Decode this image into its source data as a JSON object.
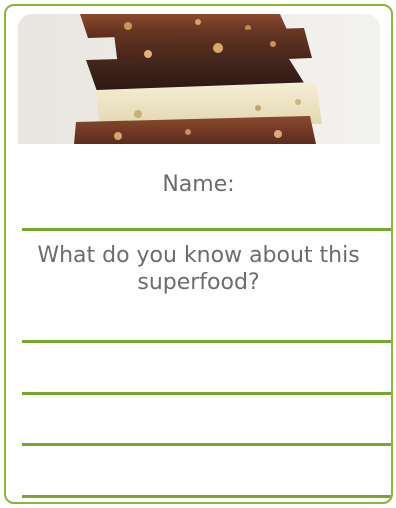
{
  "card": {
    "accent_color": "#8cb53a",
    "line_color": "#79a631",
    "text_color": "#6d6d6d",
    "image": "stacked-chocolate-bars",
    "name_label": "Name:",
    "question": "What do you know about this superfood?",
    "answer_line_count": 4
  }
}
